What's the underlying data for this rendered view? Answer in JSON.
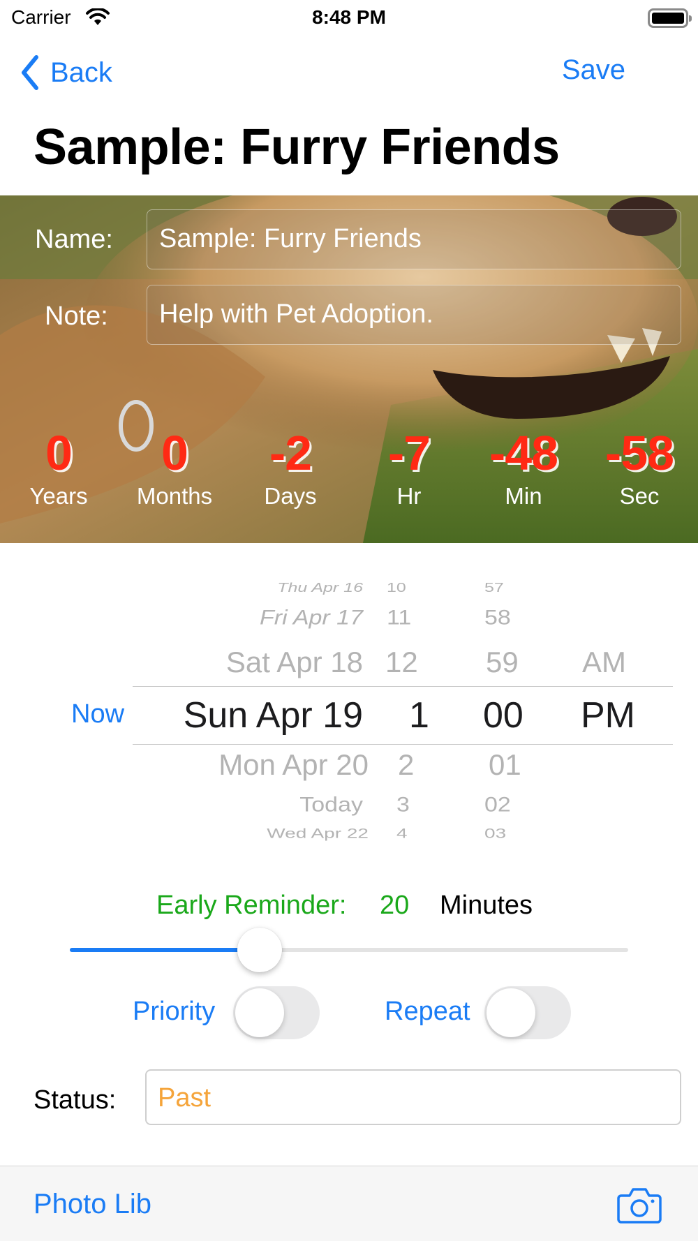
{
  "status_bar": {
    "carrier": "Carrier",
    "time": "8:48 PM"
  },
  "nav": {
    "back_label": "Back",
    "save_label": "Save",
    "title": "Sample: Furry Friends"
  },
  "form": {
    "name_label": "Name:",
    "name_value": "Sample: Furry Friends",
    "note_label": "Note:",
    "note_value": "Help with Pet Adoption."
  },
  "countdown": [
    {
      "value": "0",
      "unit": "Years"
    },
    {
      "value": "0",
      "unit": "Months"
    },
    {
      "value": "-2",
      "unit": "Days"
    },
    {
      "value": "-7",
      "unit": "Hr"
    },
    {
      "value": "-48",
      "unit": "Min"
    },
    {
      "value": "-58",
      "unit": "Sec"
    }
  ],
  "date_picker": {
    "now_label": "Now",
    "dates": [
      "Thu Apr 16",
      "Fri Apr 17",
      "Sat Apr 18",
      "Sun Apr 19",
      "Mon Apr 20",
      "Today",
      "Wed Apr 22"
    ],
    "hours": [
      "10",
      "11",
      "12",
      "1",
      "2",
      "3",
      "4"
    ],
    "minutes": [
      "57",
      "58",
      "59",
      "00",
      "01",
      "02",
      "03"
    ],
    "ampm": [
      "AM",
      "PM"
    ],
    "selected": {
      "date": "Sun Apr 19",
      "hour": "1",
      "minute": "00",
      "ampm": "PM"
    }
  },
  "reminder": {
    "label": "Early Reminder:",
    "value": "20",
    "unit": "Minutes",
    "slider_fraction": 0.34
  },
  "toggles": {
    "priority_label": "Priority",
    "priority_on": false,
    "repeat_label": "Repeat",
    "repeat_on": false
  },
  "status": {
    "label": "Status:",
    "value": "Past"
  },
  "toolbar": {
    "photo_lib_label": "Photo Lib",
    "camera_icon": "camera-icon"
  },
  "colors": {
    "accent": "#1a7cf5",
    "countdown": "#ff2a14",
    "reminder": "#1aa81a",
    "status_value": "#f5a43a"
  }
}
